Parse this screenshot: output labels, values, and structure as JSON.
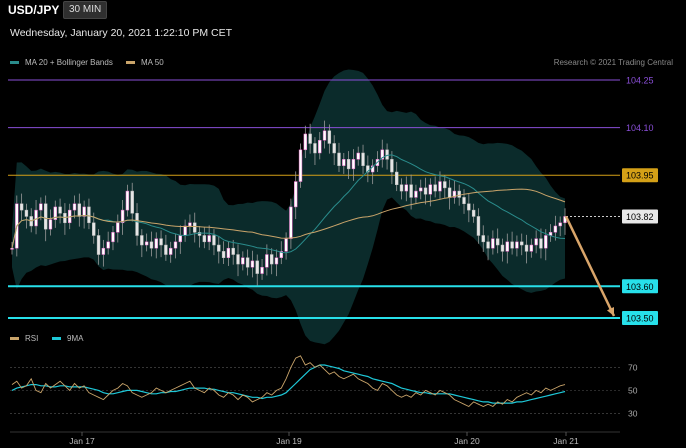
{
  "header": {
    "symbol": "USD/JPY",
    "timeframe": "30 MIN",
    "datetime": "Wednesday, January 20, 2021 1:22:10 PM CET"
  },
  "legend": [
    {
      "label": "MA 20 + Bollinger Bands",
      "color": "#2a8c8c"
    },
    {
      "label": "MA 50",
      "color": "#c9a46a"
    }
  ],
  "credit": "Research © 2021 Trading Central",
  "rsi_legend": [
    {
      "label": "RSI",
      "color": "#c9a46a"
    },
    {
      "label": "9MA",
      "color": "#1ec8d8"
    }
  ],
  "colors": {
    "background": "#000000",
    "resistance_purple": "#8a4fd8",
    "level_gold": "#d4a017",
    "support_cyan": "#27e0ea",
    "arrow": "#d9a56a",
    "candle": "#ffffff",
    "candle_shadow": "#e060c0"
  },
  "chart_data": [
    {
      "type": "candlestick",
      "instrument": "USD/JPY",
      "interval": "30 MIN",
      "y_axis": {
        "min": 103.45,
        "max": 104.3,
        "ticks": [
          "104.25",
          "104.10",
          "103.95",
          "103.82",
          "103.60",
          "103.50"
        ],
        "side": "right"
      },
      "x_axis": {
        "ticks": [
          "Jan 17",
          "Jan 19",
          "Jan 20",
          "Jan 21"
        ]
      },
      "levels": [
        {
          "value": 104.25,
          "label": "104.25",
          "kind": "resistance",
          "color": "#8a4fd8"
        },
        {
          "value": 104.1,
          "label": "104.10",
          "kind": "resistance",
          "color": "#8a4fd8"
        },
        {
          "value": 103.95,
          "label": "103.95",
          "kind": "pivot",
          "color": "#d4a017"
        },
        {
          "value": 103.82,
          "label": "103.82",
          "kind": "last",
          "color": "#cccccc"
        },
        {
          "value": 103.6,
          "label": "103.60",
          "kind": "support",
          "color": "#27e0ea"
        },
        {
          "value": 103.5,
          "label": "103.50",
          "kind": "support",
          "color": "#27e0ea"
        }
      ],
      "closes": [
        103.72,
        103.86,
        103.84,
        103.82,
        103.79,
        103.84,
        103.86,
        103.78,
        103.81,
        103.85,
        103.83,
        103.8,
        103.84,
        103.86,
        103.82,
        103.85,
        103.8,
        103.76,
        103.7,
        103.72,
        103.74,
        103.77,
        103.8,
        103.84,
        103.9,
        103.83,
        103.76,
        103.73,
        103.74,
        103.72,
        103.75,
        103.73,
        103.7,
        103.72,
        103.74,
        103.76,
        103.79,
        103.8,
        103.77,
        103.76,
        103.74,
        103.76,
        103.73,
        103.71,
        103.69,
        103.72,
        103.7,
        103.67,
        103.69,
        103.66,
        103.68,
        103.64,
        103.66,
        103.7,
        103.67,
        103.69,
        103.71,
        103.75,
        103.85,
        103.93,
        104.03,
        104.08,
        104.05,
        104.02,
        104.06,
        104.09,
        104.05,
        104.02,
        103.98,
        104.0,
        103.97,
        104.0,
        104.02,
        103.98,
        103.96,
        103.98,
        104.0,
        104.03,
        104.0,
        103.96,
        103.92,
        103.9,
        103.92,
        103.88,
        103.9,
        103.91,
        103.89,
        103.92,
        103.9,
        103.93,
        103.91,
        103.88,
        103.9,
        103.88,
        103.86,
        103.84,
        103.82,
        103.76,
        103.74,
        103.72,
        103.75,
        103.73,
        103.71,
        103.74,
        103.72,
        103.74,
        103.73,
        103.71,
        103.73,
        103.75,
        103.72,
        103.76,
        103.77,
        103.79,
        103.8,
        103.82
      ],
      "rsi": {
        "y_ticks": [
          70,
          50,
          30
        ],
        "ylim": [
          20,
          85
        ],
        "rsi": [
          55,
          58,
          52,
          54,
          60,
          50,
          48,
          56,
          52,
          55,
          58,
          54,
          50,
          56,
          52,
          54,
          48,
          46,
          44,
          42,
          46,
          50,
          52,
          56,
          54,
          48,
          46,
          44,
          46,
          48,
          52,
          50,
          48,
          50,
          52,
          54,
          56,
          58,
          52,
          50,
          48,
          52,
          50,
          46,
          44,
          48,
          46,
          42,
          46,
          44,
          40,
          42,
          44,
          48,
          46,
          50,
          52,
          60,
          70,
          78,
          80,
          72,
          74,
          70,
          72,
          68,
          64,
          66,
          62,
          60,
          62,
          64,
          60,
          58,
          56,
          52,
          50,
          56,
          54,
          50,
          46,
          44,
          46,
          44,
          48,
          46,
          50,
          48,
          46,
          50,
          48,
          46,
          42,
          40,
          38,
          36,
          40,
          38,
          36,
          38,
          36,
          40,
          38,
          42,
          40,
          44,
          46,
          48,
          46,
          50,
          48,
          52,
          50,
          52,
          54,
          55
        ],
        "ma9": [
          50,
          52,
          53,
          54,
          55,
          55,
          54,
          54,
          53,
          53,
          54,
          54,
          53,
          53,
          53,
          53,
          52,
          51,
          50,
          48,
          47,
          47,
          48,
          49,
          50,
          50,
          50,
          49,
          48,
          47,
          47,
          48,
          48,
          49,
          49,
          50,
          51,
          52,
          52,
          52,
          52,
          51,
          51,
          50,
          49,
          48,
          48,
          47,
          46,
          45,
          44,
          44,
          43,
          44,
          44,
          45,
          46,
          48,
          52,
          56,
          60,
          64,
          68,
          70,
          72,
          72,
          71,
          70,
          69,
          67,
          66,
          65,
          64,
          63,
          62,
          60,
          59,
          58,
          57,
          56,
          54,
          52,
          51,
          50,
          49,
          48,
          48,
          47,
          47,
          47,
          47,
          47,
          46,
          45,
          44,
          43,
          42,
          41,
          40,
          40,
          39,
          39,
          39,
          39,
          39,
          40,
          40,
          41,
          42,
          43,
          44,
          45,
          46,
          47,
          48,
          49
        ]
      }
    }
  ]
}
